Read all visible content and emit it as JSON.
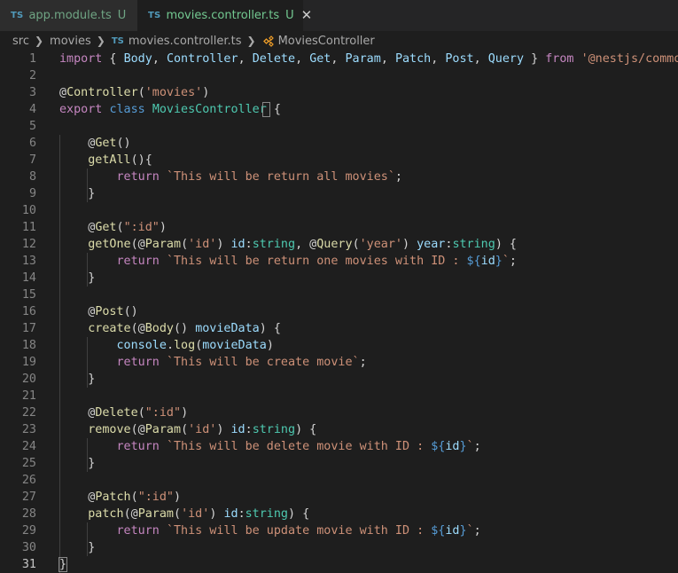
{
  "tabs": [
    {
      "badge": "TS",
      "name": "app.module.ts",
      "status": "U",
      "active": false
    },
    {
      "badge": "TS",
      "name": "movies.controller.ts",
      "status": "U",
      "active": true
    }
  ],
  "breadcrumb": {
    "items": [
      "src",
      "movies",
      "movies.controller.ts",
      "MoviesController"
    ],
    "file_badge": "TS"
  },
  "colors": {
    "background": "#1e1e1e",
    "keyword": "#569cd6",
    "control_keyword": "#c586c0",
    "type": "#4ec9b0",
    "function": "#dcdcaa",
    "string": "#ce9178",
    "variable": "#9cdcfe",
    "untracked": "#73c991"
  },
  "editor": {
    "current_line": 31,
    "lines": [
      [
        [
          "ctl",
          "import"
        ],
        [
          "pl",
          " { "
        ],
        [
          "var",
          "Body"
        ],
        [
          "pl",
          ", "
        ],
        [
          "var",
          "Controller"
        ],
        [
          "pl",
          ", "
        ],
        [
          "var",
          "Delete"
        ],
        [
          "pl",
          ", "
        ],
        [
          "var",
          "Get"
        ],
        [
          "pl",
          ", "
        ],
        [
          "var",
          "Param"
        ],
        [
          "pl",
          ", "
        ],
        [
          "var",
          "Patch"
        ],
        [
          "pl",
          ", "
        ],
        [
          "var",
          "Post"
        ],
        [
          "pl",
          ", "
        ],
        [
          "var",
          "Query"
        ],
        [
          "pl",
          " } "
        ],
        [
          "ctl",
          "from"
        ],
        [
          "pl",
          " "
        ],
        [
          "str",
          "'@nestjs/common'"
        ],
        [
          "pl",
          ";"
        ]
      ],
      [],
      [
        [
          "pl",
          "@"
        ],
        [
          "fn",
          "Controller"
        ],
        [
          "pl",
          "("
        ],
        [
          "str",
          "'movies'"
        ],
        [
          "pl",
          ")"
        ]
      ],
      [
        [
          "ctl",
          "export"
        ],
        [
          "pl",
          " "
        ],
        [
          "kw",
          "class"
        ],
        [
          "pl",
          " "
        ],
        [
          "cls",
          "MoviesController"
        ],
        [
          "pl",
          " {"
        ]
      ],
      [],
      [
        [
          "pl",
          "    @"
        ],
        [
          "fn",
          "Get"
        ],
        [
          "pl",
          "()"
        ]
      ],
      [
        [
          "pl",
          "    "
        ],
        [
          "fn",
          "getAll"
        ],
        [
          "pl",
          "(){"
        ]
      ],
      [
        [
          "pl",
          "        "
        ],
        [
          "ctl",
          "return"
        ],
        [
          "pl",
          " "
        ],
        [
          "str",
          "`This will be return all movies`"
        ],
        [
          "pl",
          ";"
        ]
      ],
      [
        [
          "pl",
          "    }"
        ]
      ],
      [],
      [
        [
          "pl",
          "    @"
        ],
        [
          "fn",
          "Get"
        ],
        [
          "pl",
          "("
        ],
        [
          "str",
          "\":id\""
        ],
        [
          "pl",
          ")"
        ]
      ],
      [
        [
          "pl",
          "    "
        ],
        [
          "fn",
          "getOne"
        ],
        [
          "pl",
          "(@"
        ],
        [
          "fn",
          "Param"
        ],
        [
          "pl",
          "("
        ],
        [
          "str",
          "'id'"
        ],
        [
          "pl",
          ") "
        ],
        [
          "var",
          "id"
        ],
        [
          "pl",
          ":"
        ],
        [
          "cls",
          "string"
        ],
        [
          "pl",
          ", @"
        ],
        [
          "fn",
          "Query"
        ],
        [
          "pl",
          "("
        ],
        [
          "str",
          "'year'"
        ],
        [
          "pl",
          ") "
        ],
        [
          "var",
          "year"
        ],
        [
          "pl",
          ":"
        ],
        [
          "cls",
          "string"
        ],
        [
          "pl",
          ") {"
        ]
      ],
      [
        [
          "pl",
          "        "
        ],
        [
          "ctl",
          "return"
        ],
        [
          "pl",
          " "
        ],
        [
          "str",
          "`This will be return one movies with ID : "
        ],
        [
          "tpl",
          "${"
        ],
        [
          "var",
          "id"
        ],
        [
          "tpl",
          "}"
        ],
        [
          "str",
          "`"
        ],
        [
          "pl",
          ";"
        ]
      ],
      [
        [
          "pl",
          "    }"
        ]
      ],
      [],
      [
        [
          "pl",
          "    @"
        ],
        [
          "fn",
          "Post"
        ],
        [
          "pl",
          "()"
        ]
      ],
      [
        [
          "pl",
          "    "
        ],
        [
          "fn",
          "create"
        ],
        [
          "pl",
          "(@"
        ],
        [
          "fn",
          "Body"
        ],
        [
          "pl",
          "() "
        ],
        [
          "var",
          "movieData"
        ],
        [
          "pl",
          ") {"
        ]
      ],
      [
        [
          "pl",
          "        "
        ],
        [
          "var",
          "console"
        ],
        [
          "pl",
          "."
        ],
        [
          "fn",
          "log"
        ],
        [
          "pl",
          "("
        ],
        [
          "var",
          "movieData"
        ],
        [
          "pl",
          ")"
        ]
      ],
      [
        [
          "pl",
          "        "
        ],
        [
          "ctl",
          "return"
        ],
        [
          "pl",
          " "
        ],
        [
          "str",
          "`This will be create movie`"
        ],
        [
          "pl",
          ";"
        ]
      ],
      [
        [
          "pl",
          "    }"
        ]
      ],
      [],
      [
        [
          "pl",
          "    @"
        ],
        [
          "fn",
          "Delete"
        ],
        [
          "pl",
          "("
        ],
        [
          "str",
          "\":id\""
        ],
        [
          "pl",
          ")"
        ]
      ],
      [
        [
          "pl",
          "    "
        ],
        [
          "fn",
          "remove"
        ],
        [
          "pl",
          "(@"
        ],
        [
          "fn",
          "Param"
        ],
        [
          "pl",
          "("
        ],
        [
          "str",
          "'id'"
        ],
        [
          "pl",
          ") "
        ],
        [
          "var",
          "id"
        ],
        [
          "pl",
          ":"
        ],
        [
          "cls",
          "string"
        ],
        [
          "pl",
          ") {"
        ]
      ],
      [
        [
          "pl",
          "        "
        ],
        [
          "ctl",
          "return"
        ],
        [
          "pl",
          " "
        ],
        [
          "str",
          "`This will be delete movie with ID : "
        ],
        [
          "tpl",
          "${"
        ],
        [
          "var",
          "id"
        ],
        [
          "tpl",
          "}"
        ],
        [
          "str",
          "`"
        ],
        [
          "pl",
          ";"
        ]
      ],
      [
        [
          "pl",
          "    }"
        ]
      ],
      [],
      [
        [
          "pl",
          "    @"
        ],
        [
          "fn",
          "Patch"
        ],
        [
          "pl",
          "("
        ],
        [
          "str",
          "\":id\""
        ],
        [
          "pl",
          ")"
        ]
      ],
      [
        [
          "pl",
          "    "
        ],
        [
          "fn",
          "patch"
        ],
        [
          "pl",
          "(@"
        ],
        [
          "fn",
          "Param"
        ],
        [
          "pl",
          "("
        ],
        [
          "str",
          "'id'"
        ],
        [
          "pl",
          ") "
        ],
        [
          "var",
          "id"
        ],
        [
          "pl",
          ":"
        ],
        [
          "cls",
          "string"
        ],
        [
          "pl",
          ") {"
        ]
      ],
      [
        [
          "pl",
          "        "
        ],
        [
          "ctl",
          "return"
        ],
        [
          "pl",
          " "
        ],
        [
          "str",
          "`This will be update movie with ID : "
        ],
        [
          "tpl",
          "${"
        ],
        [
          "var",
          "id"
        ],
        [
          "tpl",
          "}"
        ],
        [
          "str",
          "`"
        ],
        [
          "pl",
          ";"
        ]
      ],
      [
        [
          "pl",
          "    }"
        ]
      ],
      [
        [
          "pl",
          "}"
        ]
      ]
    ]
  }
}
